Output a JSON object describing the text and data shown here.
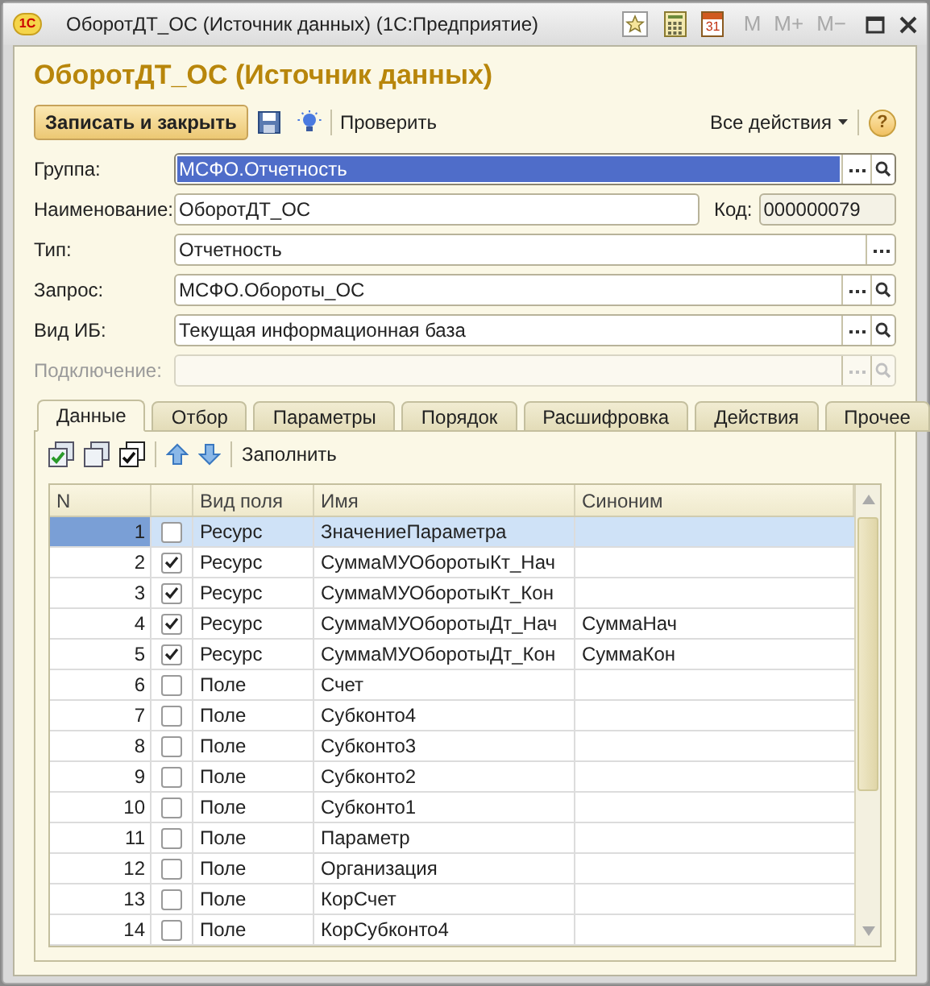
{
  "window": {
    "logo": "1С",
    "title": "ОборотДТ_ОС (Источник данных)  (1С:Предприятие)",
    "calendar_day": "31",
    "memory_buttons": [
      {
        "label": "M",
        "disabled": true
      },
      {
        "label": "M+",
        "disabled": true
      },
      {
        "label": "M−",
        "disabled": true
      }
    ]
  },
  "heading": "ОборотДТ_ОС (Источник данных)",
  "toolbar": {
    "save_close": "Записать и закрыть",
    "check": "Проверить",
    "all_actions": "Все действия",
    "help": "?"
  },
  "fields": [
    {
      "label": "Группа:",
      "value": "МСФО.Отчетность",
      "kind": "lookup",
      "selected": true,
      "disabled": false
    },
    {
      "label": "Наименование:",
      "value": "ОборотДТ_ОС",
      "kind": "text",
      "selected": false,
      "disabled": false,
      "code": {
        "label": "Код:",
        "value": "000000079"
      }
    },
    {
      "label": "Тип:",
      "value": "Отчетность",
      "kind": "choice",
      "selected": false,
      "disabled": false
    },
    {
      "label": "Запрос:",
      "value": "МСФО.Обороты_ОС",
      "kind": "lookup",
      "selected": false,
      "disabled": false
    },
    {
      "label": "Вид ИБ:",
      "value": "Текущая информационная база",
      "kind": "lookup",
      "selected": false,
      "disabled": false
    },
    {
      "label": "Подключение:",
      "kind": "lookup",
      "selected": false,
      "disabled": true
    }
  ],
  "tabs": [
    {
      "label": "Данные",
      "selected": true
    },
    {
      "label": "Отбор",
      "selected": false
    },
    {
      "label": "Параметры",
      "selected": false
    },
    {
      "label": "Порядок",
      "selected": false
    },
    {
      "label": "Расшифровка",
      "selected": false
    },
    {
      "label": "Действия",
      "selected": false
    },
    {
      "label": "Прочее",
      "selected": false
    }
  ],
  "table_toolbar": {
    "fill": "Заполнить"
  },
  "table": {
    "columns": [
      "N",
      "Вид поля",
      "Имя",
      "Синоним"
    ],
    "rows": [
      {
        "n": "1",
        "checked": false,
        "field_kind": "Ресурс",
        "name": "ЗначениеПараметра",
        "selected": true
      },
      {
        "n": "2",
        "checked": true,
        "field_kind": "Ресурс",
        "name": "СуммаМУОборотыКт_Нач",
        "selected": false
      },
      {
        "n": "3",
        "checked": true,
        "field_kind": "Ресурс",
        "name": "СуммаМУОборотыКт_Кон",
        "selected": false
      },
      {
        "n": "4",
        "checked": true,
        "field_kind": "Ресурс",
        "name": "СуммаМУОборотыДт_Нач",
        "synonym": "СуммаНач",
        "selected": false
      },
      {
        "n": "5",
        "checked": true,
        "field_kind": "Ресурс",
        "name": "СуммаМУОборотыДт_Кон",
        "synonym": "СуммаКон",
        "selected": false
      },
      {
        "n": "6",
        "checked": false,
        "field_kind": "Поле",
        "name": "Счет",
        "selected": false
      },
      {
        "n": "7",
        "checked": false,
        "field_kind": "Поле",
        "name": "Субконто4",
        "selected": false
      },
      {
        "n": "8",
        "checked": false,
        "field_kind": "Поле",
        "name": "Субконто3",
        "selected": false
      },
      {
        "n": "9",
        "checked": false,
        "field_kind": "Поле",
        "name": "Субконто2",
        "selected": false
      },
      {
        "n": "10",
        "checked": false,
        "field_kind": "Поле",
        "name": "Субконто1",
        "selected": false
      },
      {
        "n": "11",
        "checked": false,
        "field_kind": "Поле",
        "name": "Параметр",
        "selected": false
      },
      {
        "n": "12",
        "checked": false,
        "field_kind": "Поле",
        "name": "Организация",
        "selected": false
      },
      {
        "n": "13",
        "checked": false,
        "field_kind": "Поле",
        "name": "КорСчет",
        "selected": false
      },
      {
        "n": "14",
        "checked": false,
        "field_kind": "Поле",
        "name": "КорСубконто4",
        "selected": false
      }
    ]
  }
}
